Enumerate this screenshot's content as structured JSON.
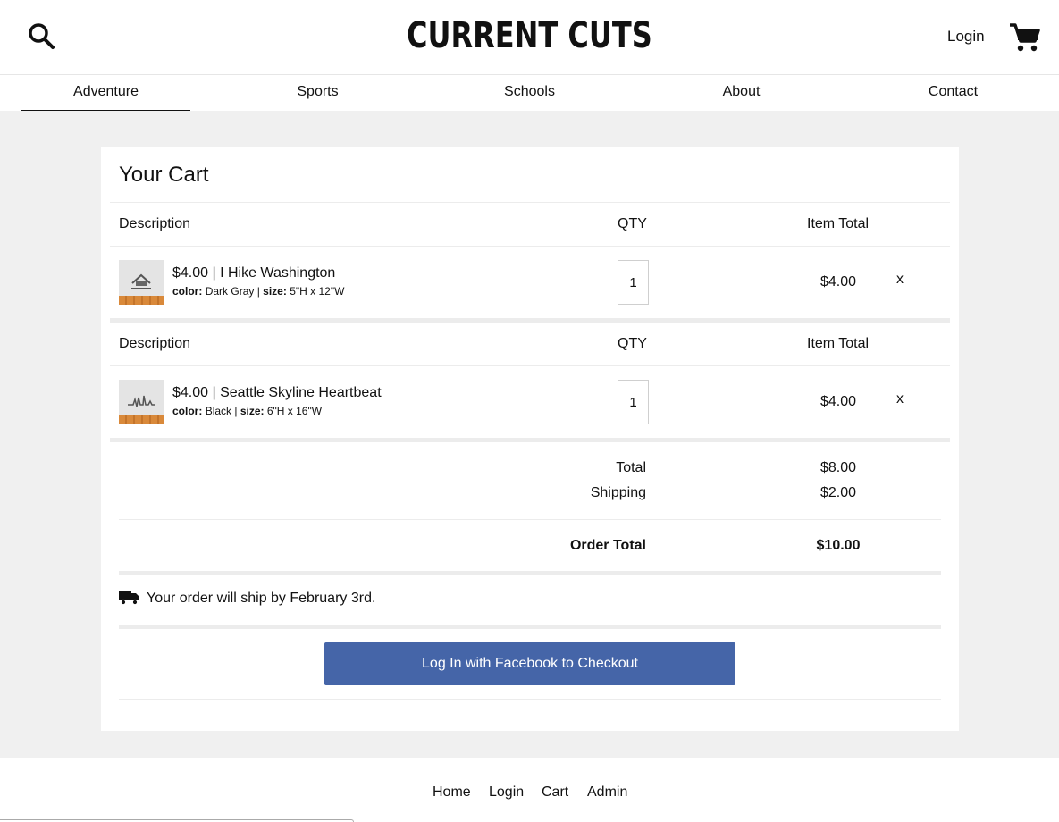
{
  "header": {
    "logo": "CURRENT CUTS",
    "login_label": "Login"
  },
  "nav": {
    "items": [
      {
        "label": "Adventure",
        "active": true
      },
      {
        "label": "Sports",
        "active": false
      },
      {
        "label": "Schools",
        "active": false
      },
      {
        "label": "About",
        "active": false
      },
      {
        "label": "Contact",
        "active": false
      }
    ]
  },
  "cart": {
    "title": "Your Cart",
    "columns": {
      "description": "Description",
      "qty": "QTY",
      "item_total": "Item Total"
    },
    "items": [
      {
        "title": "$4.00 | I Hike Washington",
        "color_label": "color:",
        "color": "Dark Gray",
        "size_label": "size:",
        "size": "5\"H x 12\"W",
        "qty": "1",
        "item_total": "$4.00",
        "remove": "x"
      },
      {
        "title": "$4.00 | Seattle Skyline Heartbeat",
        "color_label": "color:",
        "color": "Black",
        "size_label": "size:",
        "size": "6\"H x 16\"W",
        "qty": "1",
        "item_total": "$4.00",
        "remove": "x"
      }
    ],
    "summary": {
      "total_label": "Total",
      "total_value": "$8.00",
      "shipping_label": "Shipping",
      "shipping_value": "$2.00",
      "order_total_label": "Order Total",
      "order_total_value": "$10.00"
    },
    "ship_note": "Your order will ship by February 3rd.",
    "checkout_label": "Log In with Facebook to Checkout"
  },
  "footer": {
    "links": [
      "Home",
      "Login",
      "Cart",
      "Admin"
    ]
  },
  "colors": {
    "facebook_blue": "#4565a8",
    "page_bg": "#f0f0f0"
  },
  "icons": [
    "search-icon",
    "cart-icon",
    "truck-icon"
  ]
}
